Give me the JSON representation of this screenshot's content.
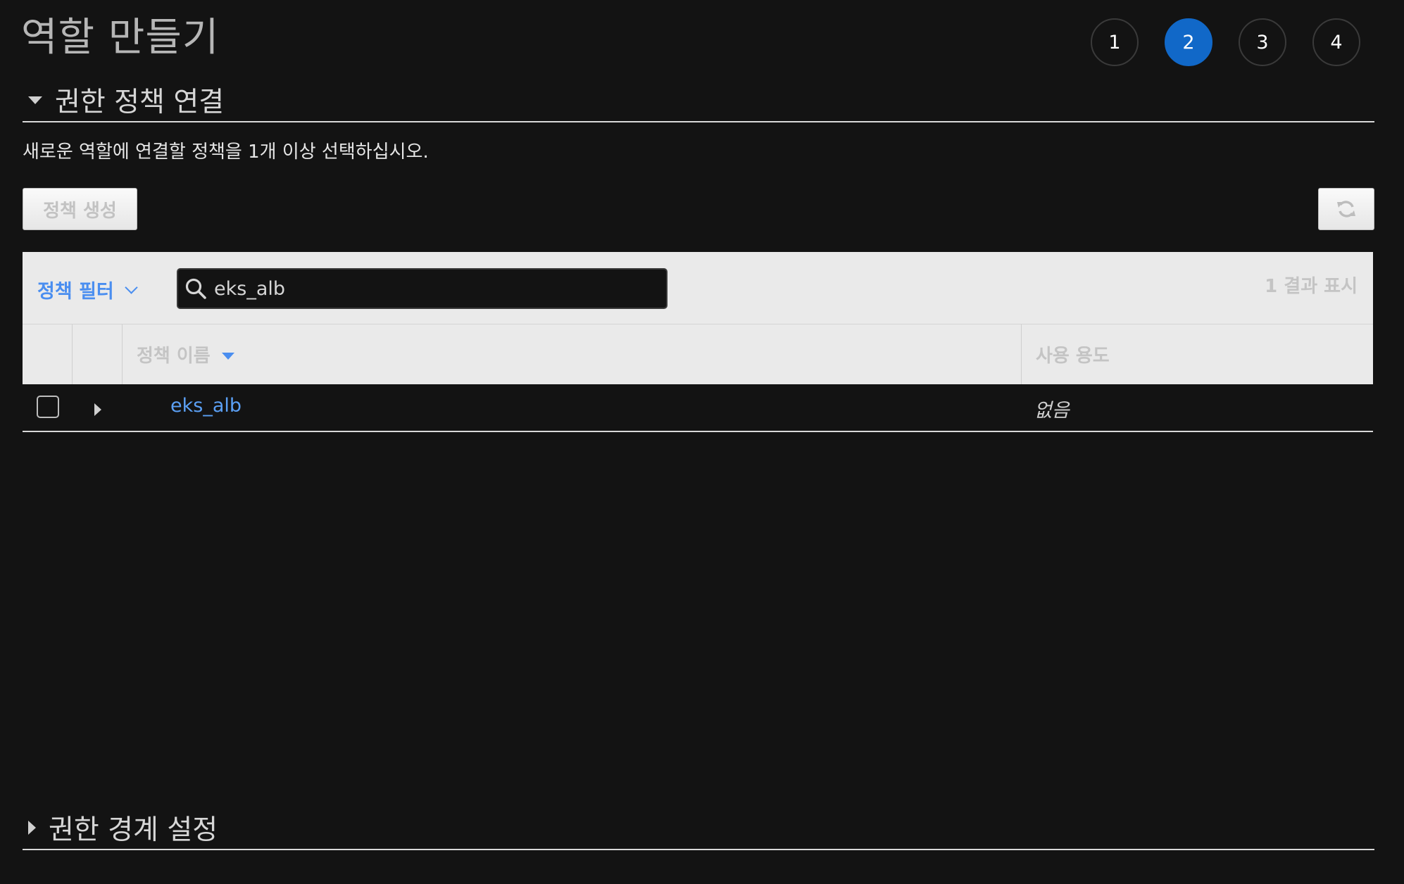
{
  "page": {
    "title": "역할 만들기"
  },
  "stepper": {
    "steps": [
      "1",
      "2",
      "3",
      "4"
    ],
    "active_step": "2"
  },
  "attach_section": {
    "title": "권한 정책 연결",
    "expanded": true,
    "description": "새로운 역할에 연결할 정책을 1개 이상 선택하십시오.",
    "create_policy_label": "정책 생성",
    "refresh_icon": "refresh-icon"
  },
  "filter": {
    "dropdown_label": "정책 필터",
    "search_value": "eks_alb",
    "search_placeholder": "",
    "result_count": "1 결과 표시"
  },
  "table": {
    "columns": [
      "정책 이름",
      "사용 용도"
    ],
    "sorted_column": "정책 이름",
    "rows": [
      {
        "selected": false,
        "name": "eks_alb",
        "usage": "없음"
      }
    ]
  },
  "boundary_section": {
    "title": "권한 경계 설정",
    "expanded": false
  },
  "colors": {
    "background": "#131313",
    "accent": "#1168c8",
    "link": "#5ba0f5"
  }
}
